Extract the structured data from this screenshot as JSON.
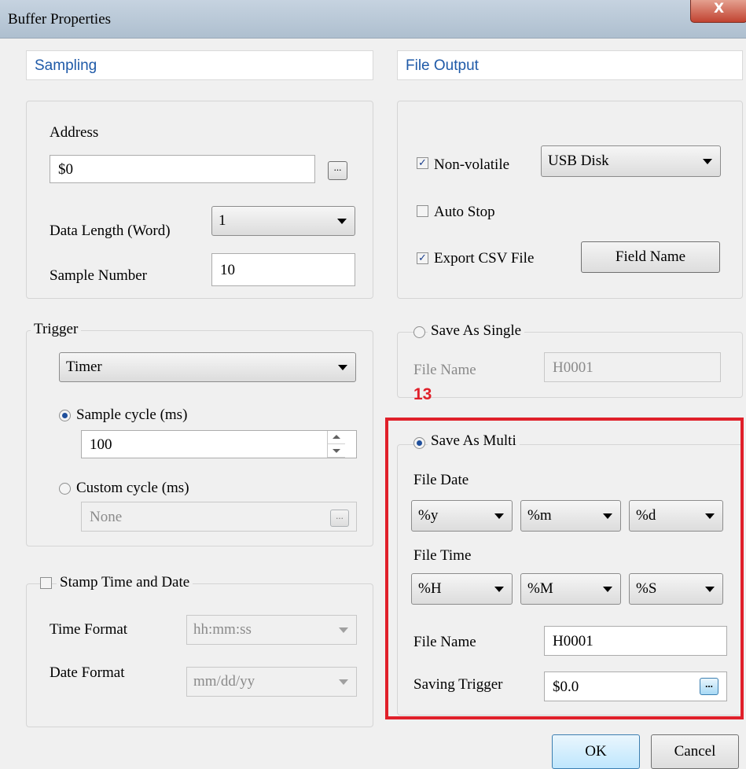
{
  "window": {
    "title": "Buffer Properties",
    "close_label": "X"
  },
  "sampling": {
    "header": "Sampling",
    "address_label": "Address",
    "address_value": "$0",
    "ellipsis": "...",
    "data_length_label": "Data Length (Word)",
    "data_length_value": "1",
    "sample_number_label": "Sample Number",
    "sample_number_value": "10"
  },
  "trigger": {
    "legend": "Trigger",
    "mode": "Timer",
    "sample_cycle_label": "Sample cycle (ms)",
    "sample_cycle_value": "100",
    "custom_cycle_label": "Custom cycle (ms)",
    "custom_cycle_value": "None",
    "ellipsis": "...",
    "sample_cycle_selected": true
  },
  "stamp": {
    "label": "Stamp Time and Date",
    "checked": false,
    "time_format_label": "Time Format",
    "time_format_value": "hh:mm:ss",
    "date_format_label": "Date Format",
    "date_format_value": "mm/dd/yy"
  },
  "file_output": {
    "header": "File Output",
    "non_volatile_label": "Non-volatile",
    "non_volatile_checked": true,
    "storage_value": "USB Disk",
    "auto_stop_label": "Auto Stop",
    "auto_stop_checked": false,
    "export_csv_label": "Export CSV File",
    "export_csv_checked": true,
    "field_name_button": "Field Name"
  },
  "save_single": {
    "label": "Save As Single",
    "file_name_label": "File Name",
    "file_name_value": "H0001"
  },
  "annotation": {
    "marker": "13",
    "color": "#e0202a"
  },
  "save_multi": {
    "label": "Save As Multi",
    "selected": true,
    "file_date_label": "File Date",
    "date_parts": [
      "%y",
      "%m",
      "%d"
    ],
    "file_time_label": "File Time",
    "time_parts": [
      "%H",
      "%M",
      "%S"
    ],
    "file_name_label": "File Name",
    "file_name_value": "H0001",
    "saving_trigger_label": "Saving Trigger",
    "saving_trigger_value": "$0.0",
    "ellipsis": "..."
  },
  "buttons": {
    "ok": "OK",
    "cancel": "Cancel"
  }
}
